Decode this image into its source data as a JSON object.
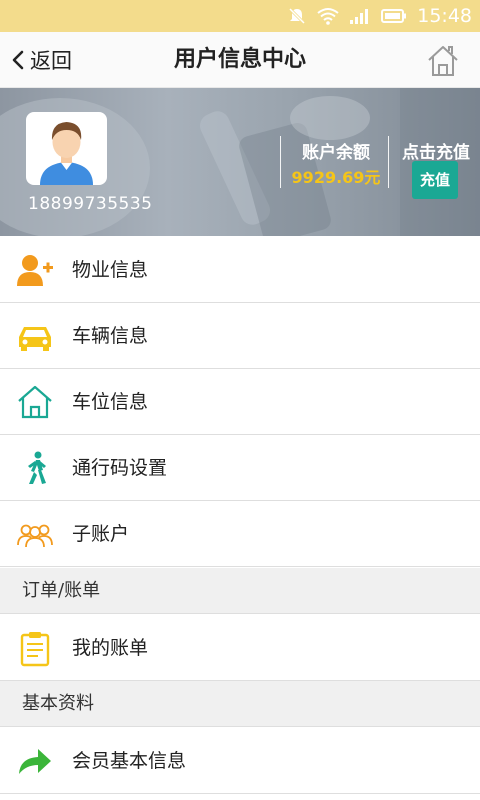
{
  "status_bar": {
    "time": "15:48"
  },
  "header": {
    "back_label": "返回",
    "title": "用户信息中心"
  },
  "profile": {
    "phone": "18899735535",
    "balance_label": "账户余额",
    "balance_value": "9929.69元",
    "recharge_label": "点击充值",
    "recharge_button": "充值"
  },
  "menu_group_1": [
    {
      "label": "物业信息",
      "icon": "property-user-icon"
    },
    {
      "label": "车辆信息",
      "icon": "car-icon"
    },
    {
      "label": "车位信息",
      "icon": "house-icon"
    },
    {
      "label": "通行码设置",
      "icon": "walking-person-icon"
    },
    {
      "label": "子账户",
      "icon": "group-users-icon"
    }
  ],
  "section_orders": {
    "label": "订单/账单"
  },
  "menu_group_2": [
    {
      "label": "我的账单",
      "icon": "clipboard-icon"
    }
  ],
  "section_basic": {
    "label": "基本资料"
  },
  "menu_group_3": [
    {
      "label": "会员基本信息",
      "icon": "share-arrow-icon"
    }
  ],
  "colors": {
    "status_bar": "#f3dc8c",
    "accent_teal": "#1aa894",
    "balance_yellow": "#f5c518",
    "icon_orange": "#f29a1d",
    "icon_yellow": "#f5c518",
    "icon_green": "#3bb53a"
  }
}
